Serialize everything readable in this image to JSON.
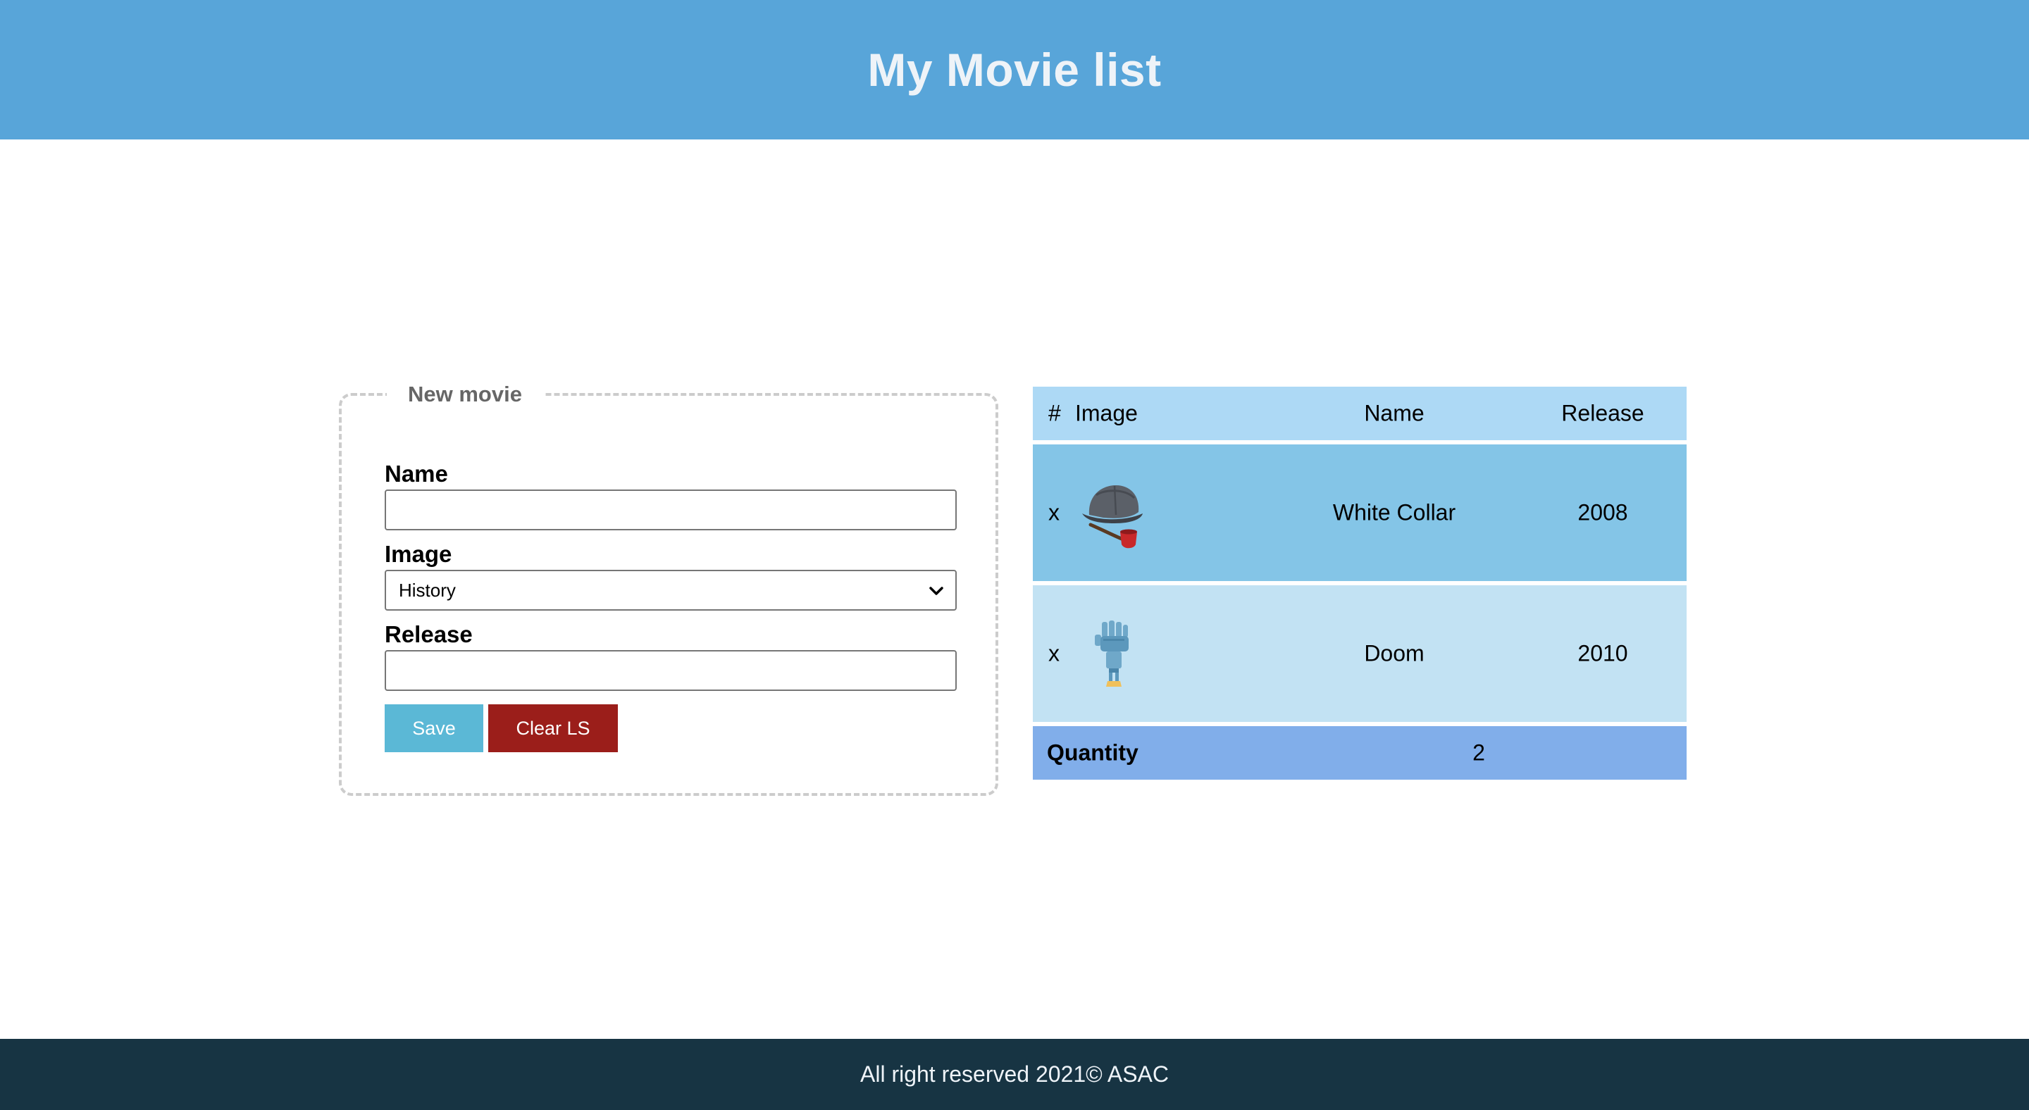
{
  "header": {
    "title": "My Movie list"
  },
  "form": {
    "legend": "New movie",
    "name_label": "Name",
    "name_value": "",
    "image_label": "Image",
    "image_selected": "History",
    "release_label": "Release",
    "release_value": "",
    "save_label": "Save",
    "clear_label": "Clear LS"
  },
  "table": {
    "headers": {
      "index": "#",
      "image": "Image",
      "name": "Name",
      "release": "Release"
    },
    "rows": [
      {
        "delete": "x",
        "icon": "detective-hat-pipe-icon",
        "name": "White Collar",
        "release": "2008"
      },
      {
        "delete": "x",
        "icon": "robot-hand-icon",
        "name": "Doom",
        "release": "2010"
      }
    ],
    "footer": {
      "label": "Quantity",
      "value": "2"
    }
  },
  "footer": {
    "text": "All right reserved 2021© ASAC"
  },
  "colors": {
    "header_bg": "#58a5d9",
    "footer_bg": "#173443",
    "save_button": "#5bb8d6",
    "clear_button": "#9b1e1a",
    "table_head": "#add9f5",
    "row_odd": "#84c5e7",
    "row_even": "#c2e2f3",
    "table_foot": "#81aeea"
  }
}
